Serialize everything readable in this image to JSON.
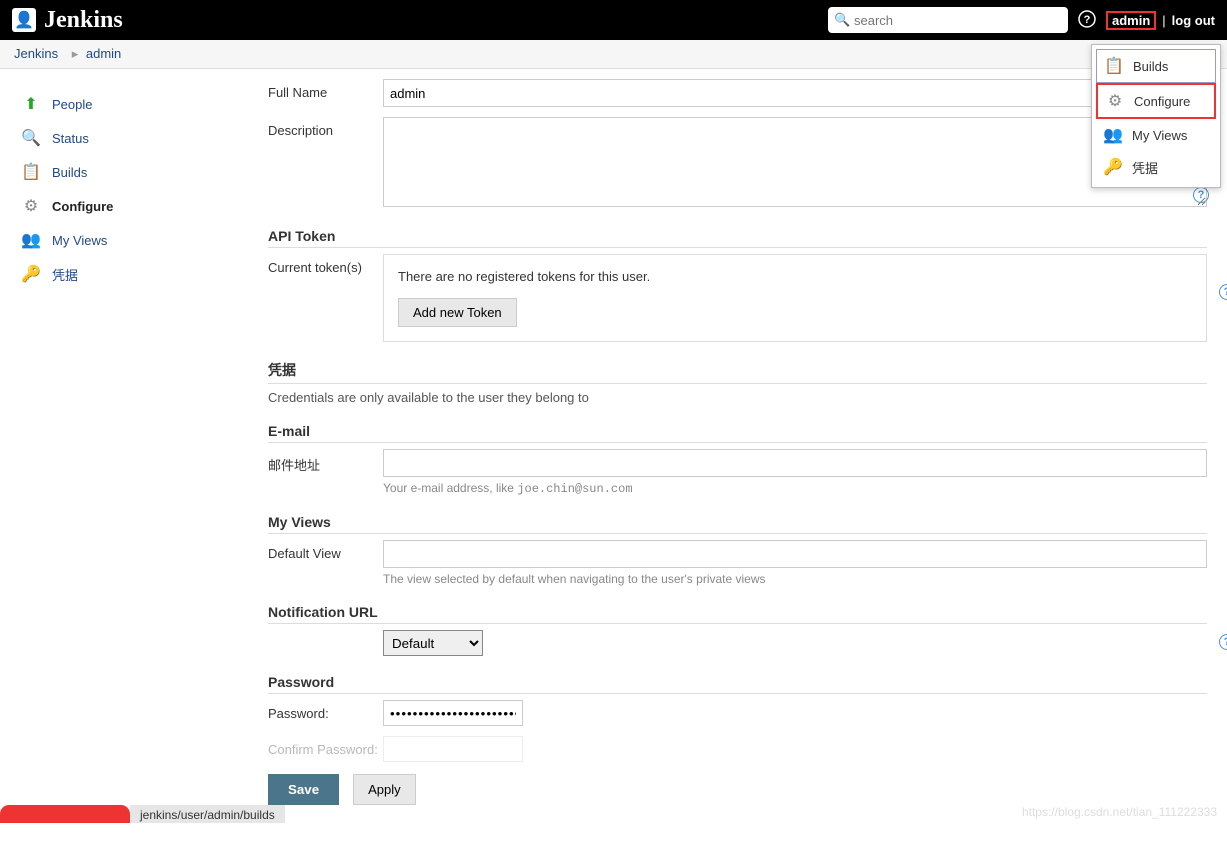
{
  "header": {
    "brand": "Jenkins",
    "search_placeholder": "search",
    "user": "admin",
    "logout": "log out",
    "separator": "|"
  },
  "breadcrumb": {
    "items": [
      "Jenkins",
      "admin"
    ]
  },
  "sidebar": {
    "items": [
      {
        "label": "People",
        "icon": "person-up-icon"
      },
      {
        "label": "Status",
        "icon": "magnifier-icon"
      },
      {
        "label": "Builds",
        "icon": "notepad-icon"
      },
      {
        "label": "Configure",
        "icon": "gear-icon",
        "active": true
      },
      {
        "label": "My Views",
        "icon": "users-icon"
      },
      {
        "label": "凭据",
        "icon": "key-icon"
      }
    ]
  },
  "dropdown": {
    "items": [
      {
        "label": "Builds",
        "icon": "notepad-icon",
        "selected": true
      },
      {
        "label": "Configure",
        "icon": "gear-icon",
        "highlight": true
      },
      {
        "label": "My Views",
        "icon": "users-icon"
      },
      {
        "label": "凭据",
        "icon": "key-icon"
      }
    ]
  },
  "form": {
    "full_name_label": "Full Name",
    "full_name_value": "admin",
    "description_label": "Description",
    "description_value": "",
    "api_token_title": "API Token",
    "current_tokens_label": "Current token(s)",
    "no_tokens_text": "There are no registered tokens for this user.",
    "add_token_btn": "Add new Token",
    "credentials_title": "凭据",
    "credentials_desc": "Credentials are only available to the user they belong to",
    "email_title": "E-mail",
    "email_label": "邮件地址",
    "email_value": "",
    "email_hint_prefix": "Your e-mail address, like ",
    "email_hint_example": "joe.chin@sun.com",
    "myviews_title": "My Views",
    "default_view_label": "Default View",
    "default_view_value": "",
    "default_view_hint": "The view selected by default when navigating to the user's private views",
    "notif_title": "Notification URL",
    "notif_options": [
      "Default"
    ],
    "password_title": "Password",
    "password_label": "Password:",
    "password_value": "••••••••••••••••••••••••••",
    "confirm_password_label": "Confirm Password:",
    "save_btn": "Save",
    "apply_btn": "Apply"
  },
  "footer": {
    "status_path": "jenkins/user/admin/builds",
    "watermark": "https://blog.csdn.net/tian_111222333"
  }
}
